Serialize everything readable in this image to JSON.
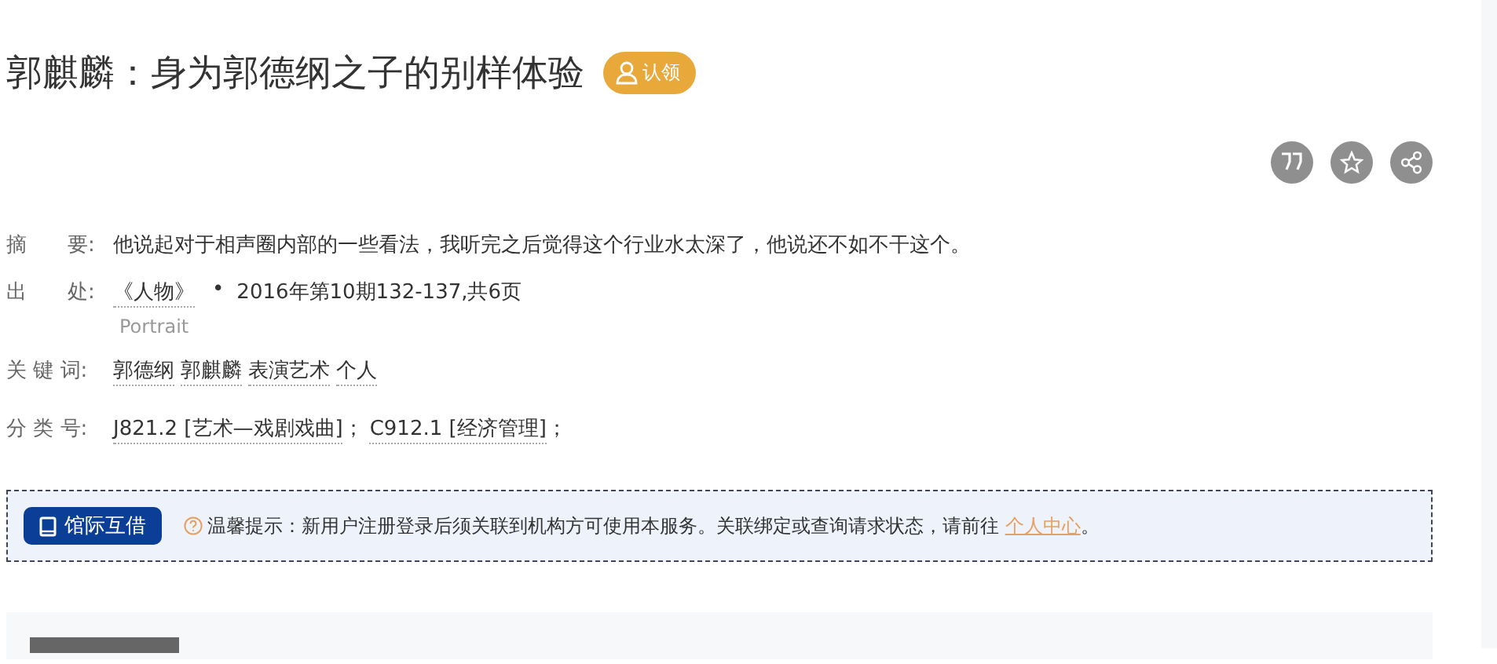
{
  "title": "郭麒麟：身为郭德纲之子的别样体验",
  "claim_badge": "认领",
  "actions": [
    {
      "kind": "quote"
    },
    {
      "kind": "star"
    },
    {
      "kind": "share"
    }
  ],
  "abstract": {
    "label": "摘　　要:",
    "text": "他说起对于相声圈内部的一些看法，我听完之后觉得这个行业水太深了，他说还不如不干这个。"
  },
  "source": {
    "label": "出　　处:",
    "journal": "《人物》",
    "journal_en": "Portrait",
    "separator": "•",
    "issue": "2016年第10期132-137,共6页"
  },
  "keywords": {
    "label": "关 键 词:",
    "items": [
      "郭德纲",
      "郭麒麟",
      "表演艺术",
      "个人"
    ]
  },
  "classification": {
    "label": "分 类 号:",
    "items": [
      {
        "code": "J821.2 [艺术—戏剧戏曲]",
        "sep": "；"
      },
      {
        "code": "C912.1 [经济管理]",
        "sep": "；"
      }
    ]
  },
  "notice": {
    "button": "馆际互借",
    "text": "温馨提示：新用户注册登录后须关联到机构方可使用本服务。关联绑定或查询请求状态，请前往 ",
    "link": "个人中心",
    "end": "。"
  }
}
